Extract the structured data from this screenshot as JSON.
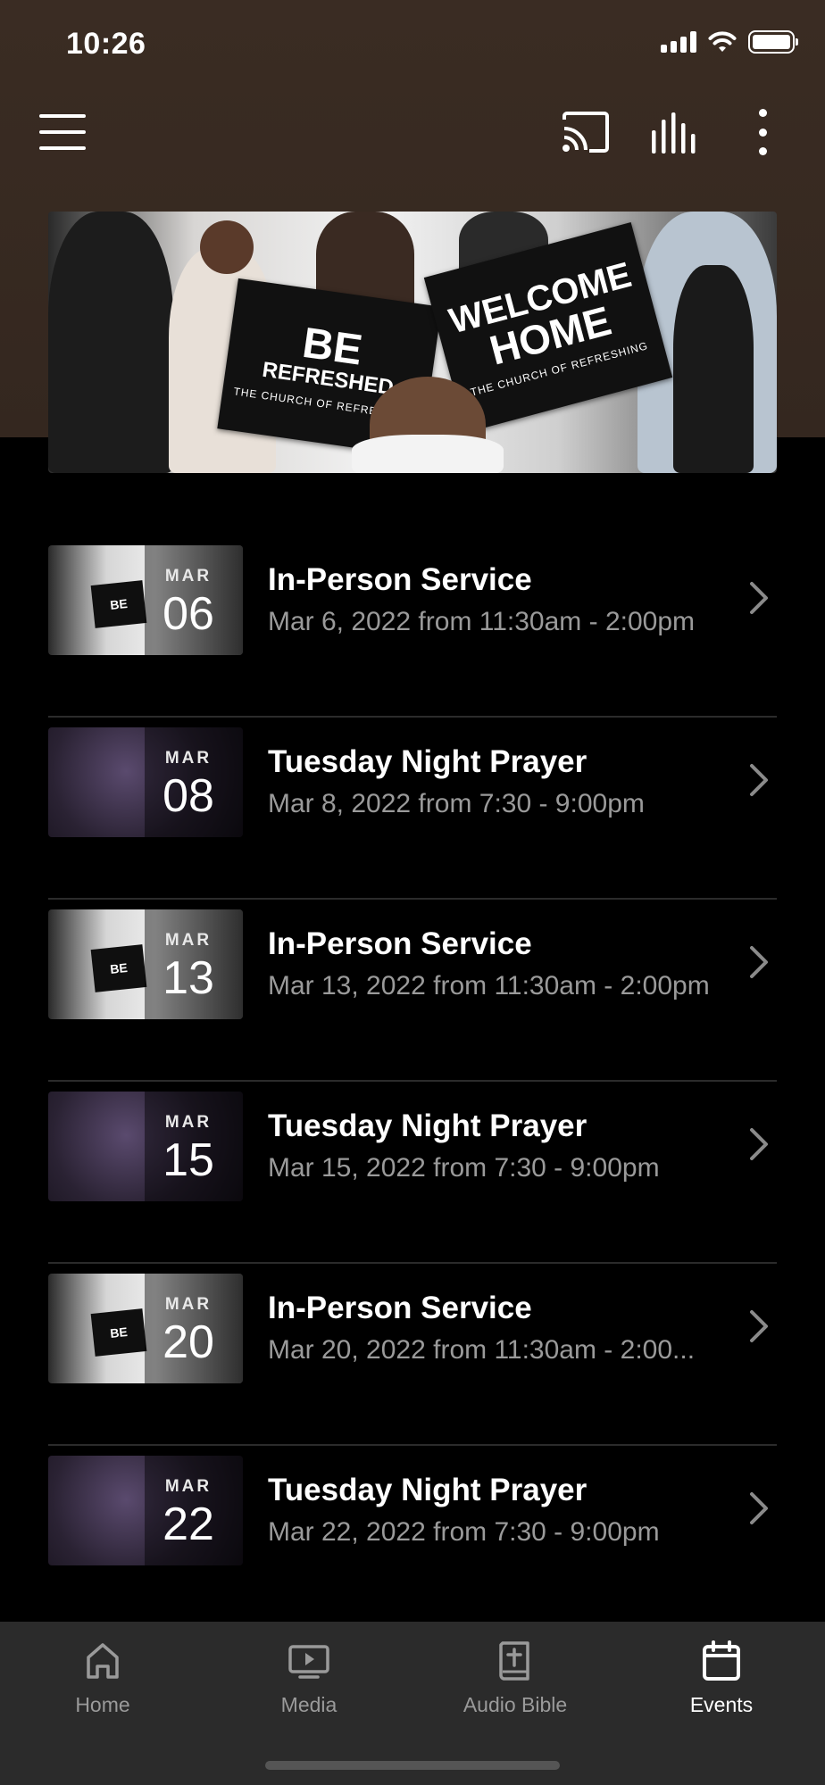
{
  "status_bar": {
    "time": "10:26"
  },
  "toolbar": {
    "icons": [
      "menu-icon",
      "cast-icon",
      "equalizer-icon",
      "more-vertical-icon"
    ]
  },
  "hero": {
    "sign_left_line1": "BE",
    "sign_left_line2": "REFRESHED",
    "sign_right_line1": "WELCOME",
    "sign_right_line2": "HOME",
    "sign_caption": "THE CHURCH OF REFRESHING"
  },
  "events": [
    {
      "month": "MAR",
      "day": "06",
      "title": "In-Person Service",
      "time": "Mar 6, 2022 from 11:30am - 2:00pm",
      "thumb": "service"
    },
    {
      "month": "MAR",
      "day": "08",
      "title": "Tuesday Night Prayer",
      "time": "Mar 8, 2022 from 7:30 - 9:00pm",
      "thumb": "prayer"
    },
    {
      "month": "MAR",
      "day": "13",
      "title": "In-Person Service",
      "time": "Mar 13, 2022 from 11:30am - 2:00pm",
      "thumb": "service"
    },
    {
      "month": "MAR",
      "day": "15",
      "title": "Tuesday Night Prayer",
      "time": "Mar 15, 2022 from 7:30 - 9:00pm",
      "thumb": "prayer"
    },
    {
      "month": "MAR",
      "day": "20",
      "title": "In-Person Service",
      "time": "Mar 20, 2022 from 11:30am - 2:00...",
      "thumb": "service"
    },
    {
      "month": "MAR",
      "day": "22",
      "title": "Tuesday Night Prayer",
      "time": "Mar 22, 2022 from 7:30 - 9:00pm",
      "thumb": "prayer"
    }
  ],
  "bottom_nav": {
    "items": [
      {
        "label": "Home",
        "icon": "home-icon",
        "active": false
      },
      {
        "label": "Media",
        "icon": "tv-play-icon",
        "active": false
      },
      {
        "label": "Audio Bible",
        "icon": "bible-icon",
        "active": false
      },
      {
        "label": "Events",
        "icon": "calendar-icon",
        "active": true
      }
    ]
  },
  "colors": {
    "header_bg": "#3a2c23",
    "list_bg": "#000000",
    "nav_bg": "#2b2b2b",
    "secondary_text": "#9a9a9a",
    "active_nav": "#ffffff"
  }
}
